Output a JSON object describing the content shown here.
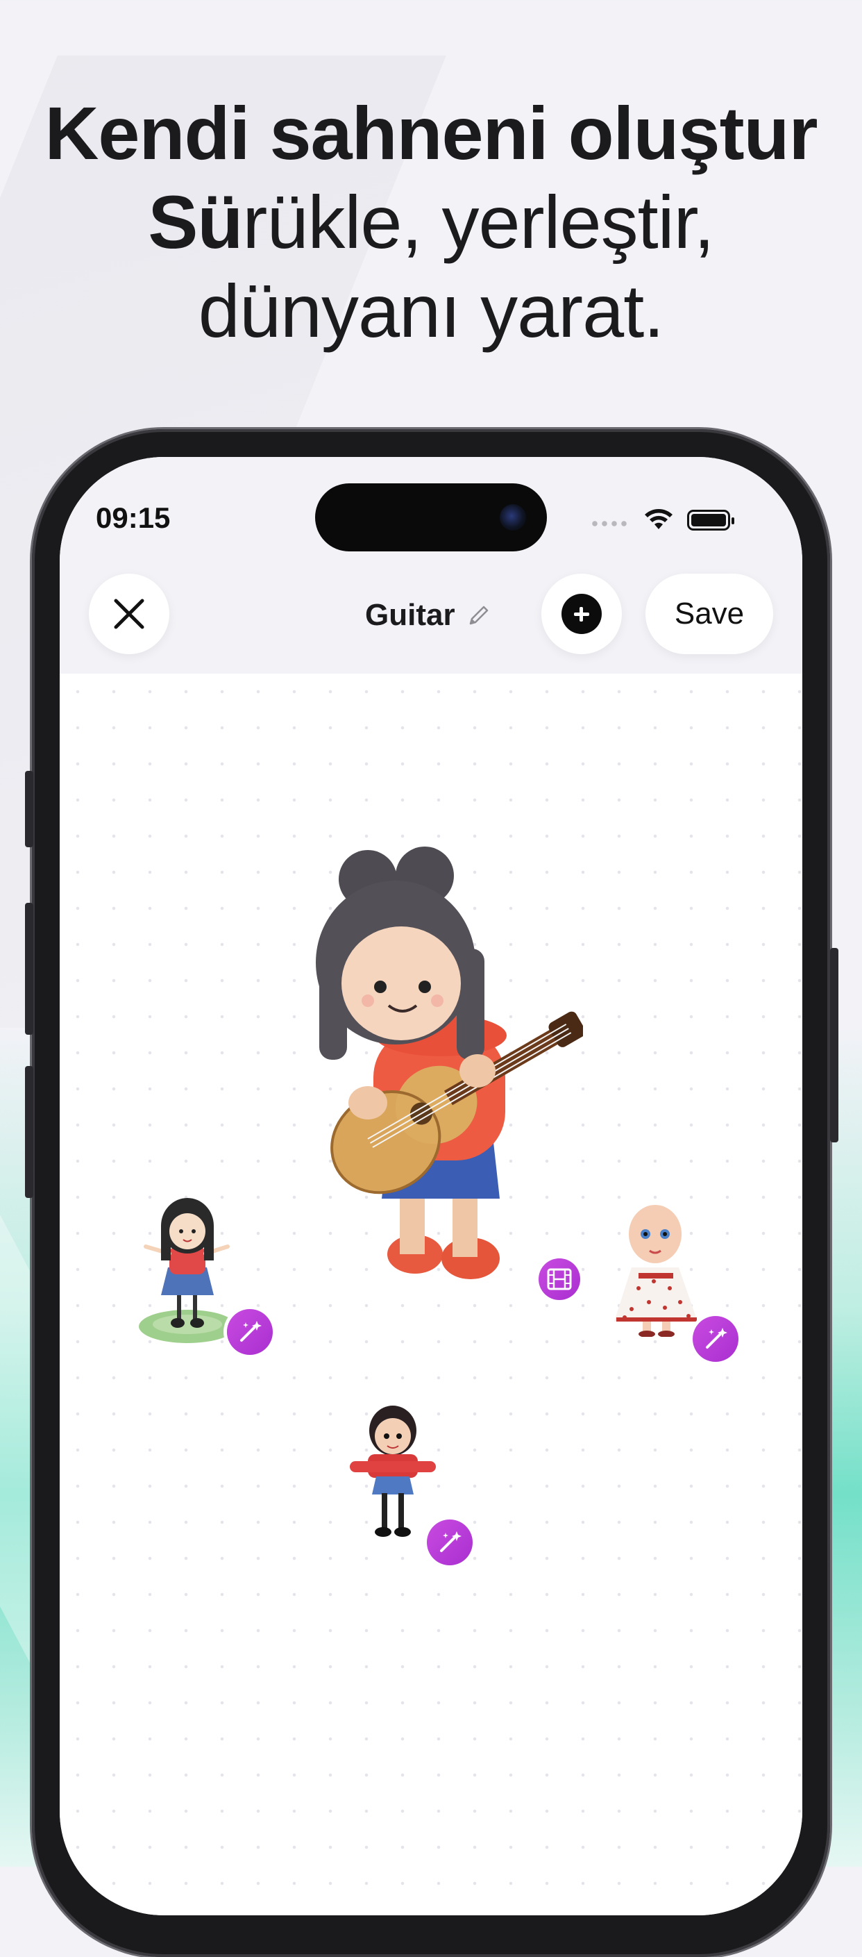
{
  "headline": {
    "line1": "Kendi sahneni oluştur",
    "line2_bold": "Sü",
    "line2_rest": "rükle, yerleştir,",
    "line3": "dünyanı yarat."
  },
  "status_bar": {
    "time": "09:15"
  },
  "toolbar": {
    "close_icon": "close-icon",
    "title": "Guitar",
    "edit_icon": "pencil-icon",
    "add_icon": "plus-circle-icon",
    "save_label": "Save"
  },
  "canvas": {
    "stickers": [
      {
        "name": "girl-with-guitar-figure",
        "badge": null
      },
      {
        "name": "girl-on-stand-figure",
        "badge": "magic-wand-icon"
      },
      {
        "name": "baby-doll-figure",
        "badge": "magic-wand-icon"
      },
      {
        "name": "small-girl-figure",
        "badge": "magic-wand-icon"
      }
    ],
    "film_badge": "film-icon"
  },
  "colors": {
    "accent_badge": "#b83dd8",
    "background_top": "#f2f2f7",
    "background_bottom": "#74e0c8"
  }
}
